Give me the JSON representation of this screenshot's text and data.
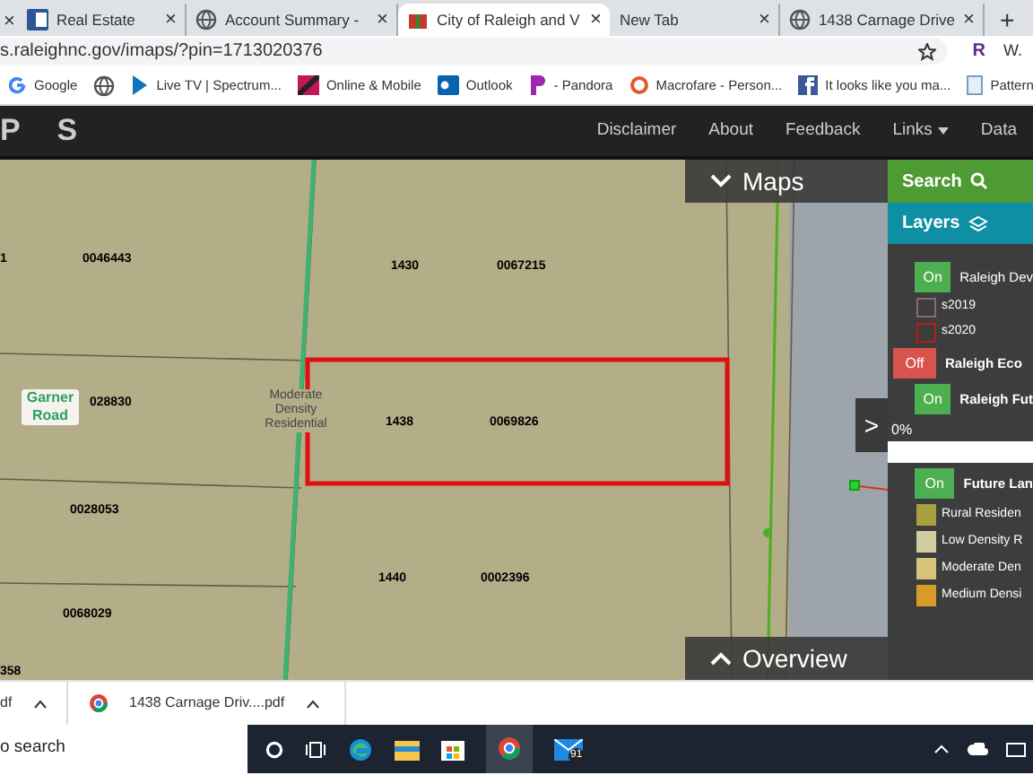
{
  "leading_close": "×",
  "tabs": [
    {
      "label": "Real Estate",
      "close": "×",
      "selected": false
    },
    {
      "label": "Account Summary -",
      "close": "×",
      "selected": false
    },
    {
      "label": "City of Raleigh and V",
      "close": "×",
      "selected": true
    },
    {
      "label": "New Tab",
      "close": "×",
      "selected": false
    },
    {
      "label": "1438 Carnage Drive",
      "close": "×",
      "selected": false
    }
  ],
  "new_tab": "+",
  "address": "s.raleighnc.gov/imaps/?pin=1713020376",
  "profile": "R",
  "extension": "W.",
  "bookmarks": [
    {
      "label": "Google"
    },
    {
      "label": "Live TV | Spectrum..."
    },
    {
      "label": "Online & Mobile"
    },
    {
      "label": "Outlook"
    },
    {
      "label": "- Pandora"
    },
    {
      "label": "Macrofare - Person..."
    },
    {
      "label": "It looks like you ma..."
    },
    {
      "label": "Pattern"
    }
  ],
  "nav": {
    "brand": "P S",
    "links": [
      {
        "label": "Disclaimer",
        "dropdown": false
      },
      {
        "label": "About",
        "dropdown": false
      },
      {
        "label": "Feedback",
        "dropdown": false
      },
      {
        "label": "Links",
        "dropdown": true
      },
      {
        "label": "Data",
        "dropdown": false
      }
    ]
  },
  "map": {
    "labels": [
      {
        "text": "1",
        "kind": "id"
      },
      {
        "text": "0046443",
        "kind": "id"
      },
      {
        "text": "1430",
        "kind": "id"
      },
      {
        "text": "0067215",
        "kind": "id"
      },
      {
        "text": "Garner Road",
        "kind": "road"
      },
      {
        "text": "028830",
        "kind": "id"
      },
      {
        "text": "Moderate Density Residential",
        "kind": "zone"
      },
      {
        "text": "1438",
        "kind": "id"
      },
      {
        "text": "0069826",
        "kind": "id"
      },
      {
        "text": "0028053",
        "kind": "id"
      },
      {
        "text": "1440",
        "kind": "id"
      },
      {
        "text": "0002396",
        "kind": "id"
      },
      {
        "text": "0068029",
        "kind": "id"
      },
      {
        "text": "358",
        "kind": "id"
      }
    ],
    "maps_panel": "Maps",
    "overview_panel": "Overview"
  },
  "sidebar": {
    "search": "Search",
    "layers": "Layers",
    "collapse": ">",
    "items": [
      {
        "kind": "toggle",
        "on": true,
        "button": "On",
        "label": "Raleigh Dev"
      },
      {
        "kind": "outline",
        "color": "#8a6a6a",
        "label": "s2019"
      },
      {
        "kind": "outline",
        "color": "#c01818",
        "label": "s2020"
      },
      {
        "kind": "toggle",
        "on": false,
        "button": "Off",
        "label": "Raleigh Eco"
      },
      {
        "kind": "toggle",
        "on": true,
        "button": "On",
        "label": "Raleigh Fut"
      },
      {
        "kind": "progress",
        "label": "0%",
        "level": 0
      },
      {
        "kind": "toggle",
        "on": true,
        "button": "On",
        "label": "Future Lan"
      },
      {
        "kind": "swatch",
        "color": "#a8a040",
        "label": "Rural Residen"
      },
      {
        "kind": "swatch",
        "color": "#d0cca0",
        "label": "Low Density R"
      },
      {
        "kind": "swatch",
        "color": "#d6c27a",
        "label": "Moderate Den"
      },
      {
        "kind": "swatch",
        "color": "#d89a28",
        "label": "Medium Densi"
      }
    ]
  },
  "downloads": [
    {
      "label": "df"
    },
    {
      "label": "1438 Carnage Driv....pdf"
    }
  ],
  "taskbar": {
    "search": "o search",
    "mail_badge": "91"
  }
}
